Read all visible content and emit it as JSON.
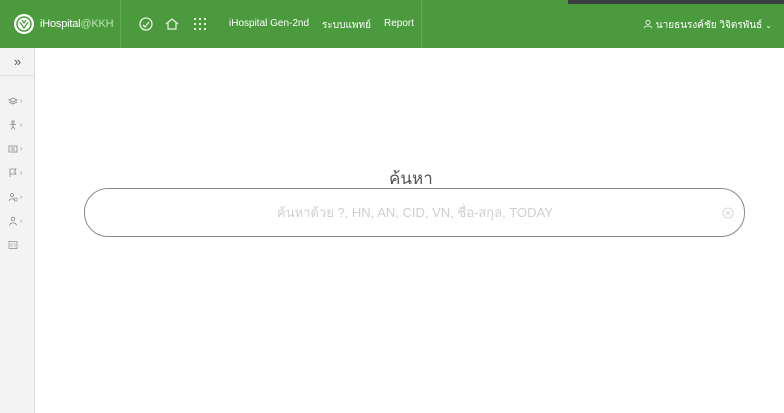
{
  "header": {
    "brand_name": "iHospital",
    "brand_suffix": "@KKH",
    "links": {
      "gen2": "iHospital Gen-2nd",
      "doctor": "ระบบแพทย์",
      "report": "Report"
    },
    "user_name": "นายธนรงค์ชัย วิจิตรพันธ์"
  },
  "sidebar": {
    "toggle_label": "»"
  },
  "search": {
    "title": "ค้นหา",
    "placeholder": "ค้นหาด้วย ?, HN, AN, CID, VN, ชื่อ-สกุล, TODAY",
    "value": ""
  },
  "colors": {
    "header_bg": "#4c9a3e",
    "sidebar_bg": "#f3f3f3"
  }
}
